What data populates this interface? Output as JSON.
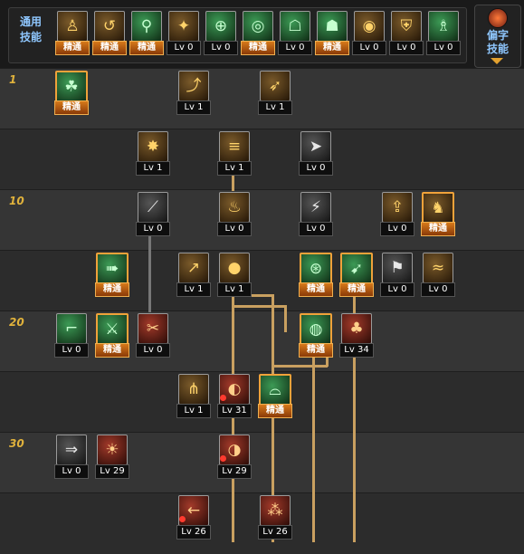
{
  "common_skills": {
    "label_line1": "通用",
    "label_line2": "技能",
    "items": [
      {
        "icon": "person-sitting-icon",
        "badge": "精通",
        "color": "brown"
      },
      {
        "icon": "person-flip-icon",
        "badge": "精通",
        "color": "brown"
      },
      {
        "icon": "person-run-icon",
        "badge": "精通",
        "color": "green"
      },
      {
        "icon": "wings-icon",
        "badge": "Lv 0",
        "color": "brown"
      },
      {
        "icon": "crosshair-icon",
        "badge": "Lv 0",
        "color": "green"
      },
      {
        "icon": "crosshair-target-icon",
        "badge": "精通",
        "color": "green"
      },
      {
        "icon": "meditate-icon",
        "badge": "Lv 0",
        "color": "green"
      },
      {
        "icon": "meditate-aura-icon",
        "badge": "精通",
        "color": "green"
      },
      {
        "icon": "eye-icon",
        "badge": "Lv 0",
        "color": "brown"
      },
      {
        "icon": "armor-icon",
        "badge": "Lv 0",
        "color": "brown"
      },
      {
        "icon": "pose-icon",
        "badge": "Lv 0",
        "color": "green"
      }
    ]
  },
  "special_skills": {
    "label_line1": "偏字",
    "label_line2": "技能"
  },
  "level_markers": [
    "1",
    "10",
    "20",
    "30"
  ],
  "tree": [
    {
      "name": "skill-lizard",
      "icon": "lizard-icon",
      "color": "green",
      "badge": "精通",
      "selected": true,
      "col": 0,
      "row": 0
    },
    {
      "name": "skill-jump-attack",
      "icon": "jump-icon",
      "color": "brown",
      "badge": "Lv 1",
      "col": 3,
      "row": 0
    },
    {
      "name": "skill-kick",
      "icon": "kick-icon",
      "color": "brown",
      "badge": "Lv 1",
      "col": 5,
      "row": 0
    },
    {
      "name": "skill-burst",
      "icon": "burst-icon",
      "color": "brown",
      "badge": "Lv 1",
      "col": 2,
      "row": 1
    },
    {
      "name": "skill-rapid-shot",
      "icon": "rapid-shot-icon",
      "color": "brown",
      "badge": "Lv 1",
      "col": 4,
      "row": 1
    },
    {
      "name": "skill-gun-shot",
      "icon": "gun-icon",
      "color": "dark",
      "badge": "Lv 0",
      "col": 6,
      "row": 1
    },
    {
      "name": "skill-slash",
      "icon": "slash-icon",
      "color": "dark",
      "badge": "Lv 0",
      "col": 2,
      "row": 2
    },
    {
      "name": "skill-flame",
      "icon": "flame-icon",
      "color": "brown",
      "badge": "Lv 0",
      "col": 4,
      "row": 2
    },
    {
      "name": "skill-lightning",
      "icon": "lightning-icon",
      "color": "dark",
      "badge": "Lv 0",
      "col": 6,
      "row": 2
    },
    {
      "name": "skill-upload",
      "icon": "upload-icon",
      "color": "brown",
      "badge": "Lv 0",
      "col": 8,
      "row": 2
    },
    {
      "name": "skill-beast-face",
      "icon": "beast-icon",
      "color": "brown",
      "badge": "精通",
      "selected": true,
      "col": 9,
      "row": 2
    },
    {
      "name": "skill-dash-shot",
      "icon": "dash-icon",
      "color": "green",
      "badge": "精通",
      "selected": true,
      "col": 1,
      "row": 3
    },
    {
      "name": "skill-grenade-toss",
      "icon": "toss-icon",
      "color": "brown",
      "badge": "Lv 1",
      "col": 3,
      "row": 3
    },
    {
      "name": "skill-grenade",
      "icon": "grenade-icon",
      "color": "brown",
      "badge": "Lv 1",
      "col": 4,
      "row": 3
    },
    {
      "name": "skill-on-toggle",
      "icon": "on-icon",
      "color": "green",
      "badge": "精通",
      "selected": true,
      "col": 6,
      "row": 3
    },
    {
      "name": "skill-rocket",
      "icon": "rocket-icon",
      "color": "green",
      "badge": "精通",
      "selected": true,
      "col": 7,
      "row": 3
    },
    {
      "name": "skill-run-shock",
      "icon": "runner-icon",
      "color": "dark",
      "badge": "Lv 0",
      "col": 8,
      "row": 3
    },
    {
      "name": "skill-wave",
      "icon": "wave-icon",
      "color": "brown",
      "badge": "Lv 0",
      "col": 9,
      "row": 3
    },
    {
      "name": "skill-revolver",
      "icon": "revolver-icon",
      "color": "green",
      "badge": "Lv 0",
      "col": 0,
      "row": 4
    },
    {
      "name": "skill-crossbow",
      "icon": "crossbow-icon",
      "color": "green",
      "badge": "精通",
      "selected": true,
      "col": 1,
      "row": 4
    },
    {
      "name": "skill-blade-red",
      "icon": "blade-icon",
      "color": "red",
      "badge": "Lv 0",
      "col": 2,
      "row": 4
    },
    {
      "name": "skill-bomb-green",
      "icon": "bomb-icon",
      "color": "green",
      "badge": "精通",
      "selected": true,
      "col": 6,
      "row": 4
    },
    {
      "name": "skill-bell",
      "icon": "bell-icon",
      "color": "red",
      "badge": "Lv 34",
      "col": 7,
      "row": 4
    },
    {
      "name": "skill-claw",
      "icon": "claw-icon",
      "color": "brown",
      "badge": "Lv 1",
      "col": 3,
      "row": 5
    },
    {
      "name": "skill-mine",
      "icon": "mine-icon",
      "color": "red",
      "badge": "Lv 31",
      "lock": true,
      "col": 4,
      "row": 5
    },
    {
      "name": "skill-dome",
      "icon": "dome-icon",
      "color": "green",
      "badge": "精通",
      "selected": true,
      "col": 5,
      "row": 5
    },
    {
      "name": "skill-bullet",
      "icon": "bullet-icon",
      "color": "dark",
      "badge": "Lv 0",
      "col": 0,
      "row": 6
    },
    {
      "name": "skill-fire-red",
      "icon": "fire-icon",
      "color": "red",
      "badge": "Lv 29",
      "col": 1,
      "row": 6
    },
    {
      "name": "skill-bomb-red",
      "icon": "bomb-red-icon",
      "color": "red",
      "badge": "Lv 29",
      "lock": true,
      "col": 4,
      "row": 6
    },
    {
      "name": "skill-arrow-red",
      "icon": "arrow-icon",
      "color": "red",
      "badge": "Lv 26",
      "lock": true,
      "col": 3,
      "row": 7
    },
    {
      "name": "skill-rain-red",
      "icon": "rain-icon",
      "color": "red",
      "badge": "Lv 26",
      "col": 5,
      "row": 7
    }
  ],
  "glyphs": {
    "person-sitting-icon": "♙",
    "person-flip-icon": "↺",
    "person-run-icon": "⚲",
    "wings-icon": "✦",
    "crosshair-icon": "⊕",
    "crosshair-target-icon": "◎",
    "meditate-icon": "☖",
    "meditate-aura-icon": "☗",
    "eye-icon": "◉",
    "armor-icon": "⛨",
    "pose-icon": "♗",
    "lizard-icon": "☘",
    "jump-icon": "⤴",
    "kick-icon": "➶",
    "burst-icon": "✸",
    "rapid-shot-icon": "≡",
    "gun-icon": "➤",
    "slash-icon": "⟋",
    "flame-icon": "♨",
    "lightning-icon": "⚡",
    "upload-icon": "⇪",
    "beast-icon": "♞",
    "dash-icon": "➠",
    "toss-icon": "↗",
    "grenade-icon": "●",
    "on-icon": "⊛",
    "rocket-icon": "➹",
    "runner-icon": "⚑",
    "wave-icon": "≈",
    "revolver-icon": "⌐",
    "crossbow-icon": "⚔",
    "blade-icon": "✂",
    "bomb-icon": "◍",
    "bell-icon": "♣",
    "claw-icon": "⋔",
    "mine-icon": "◐",
    "dome-icon": "⌓",
    "bullet-icon": "⇒",
    "fire-icon": "☀",
    "bomb-red-icon": "◑",
    "arrow-icon": "←",
    "rain-icon": "⁂"
  }
}
